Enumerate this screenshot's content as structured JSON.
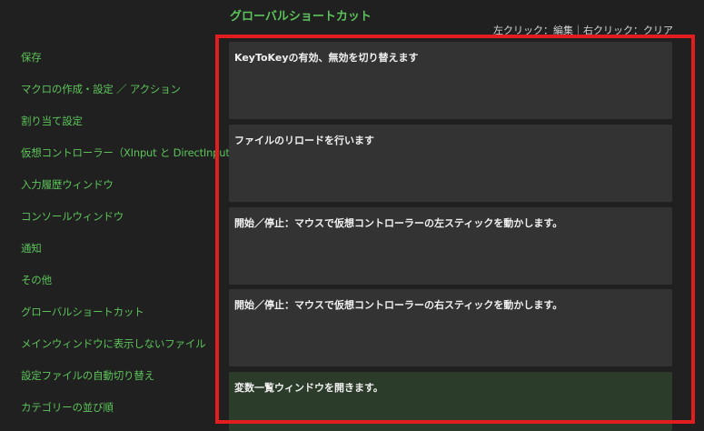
{
  "header": {
    "title": "グローバルショートカット",
    "hint": "左クリック：編集｜右クリック：クリア"
  },
  "sidebar": {
    "items": [
      {
        "label": "保存"
      },
      {
        "label": "マクロの作成・設定 ／ アクション"
      },
      {
        "label": "割り当て設定"
      },
      {
        "label": "仮想コントローラー（XInput と DirectInput）"
      },
      {
        "label": "入力履歴ウィンドウ"
      },
      {
        "label": "コンソールウィンドウ"
      },
      {
        "label": "通知"
      },
      {
        "label": "その他"
      },
      {
        "label": "グローバルショートカット"
      },
      {
        "label": "メインウィンドウに表示しないファイル"
      },
      {
        "label": "設定ファイルの自動切り替え"
      },
      {
        "label": "カテゴリーの並び順"
      }
    ]
  },
  "shortcuts": [
    {
      "description": "KeyToKeyの有効、無効を切り替えます"
    },
    {
      "description": "ファイルのリロードを行います"
    },
    {
      "description": "開始／停止：マウスで仮想コントローラーの左スティックを動かします。"
    },
    {
      "description": "開始／停止：マウスで仮想コントローラーの右スティックを動かします。"
    },
    {
      "description": "変数一覧ウィンドウを開きます。"
    }
  ],
  "colors": {
    "accent": "#5cc35a",
    "background": "#202020",
    "panel": "#333333",
    "panel_selected": "#2c3c2a",
    "highlight_border": "#e11d1d"
  }
}
